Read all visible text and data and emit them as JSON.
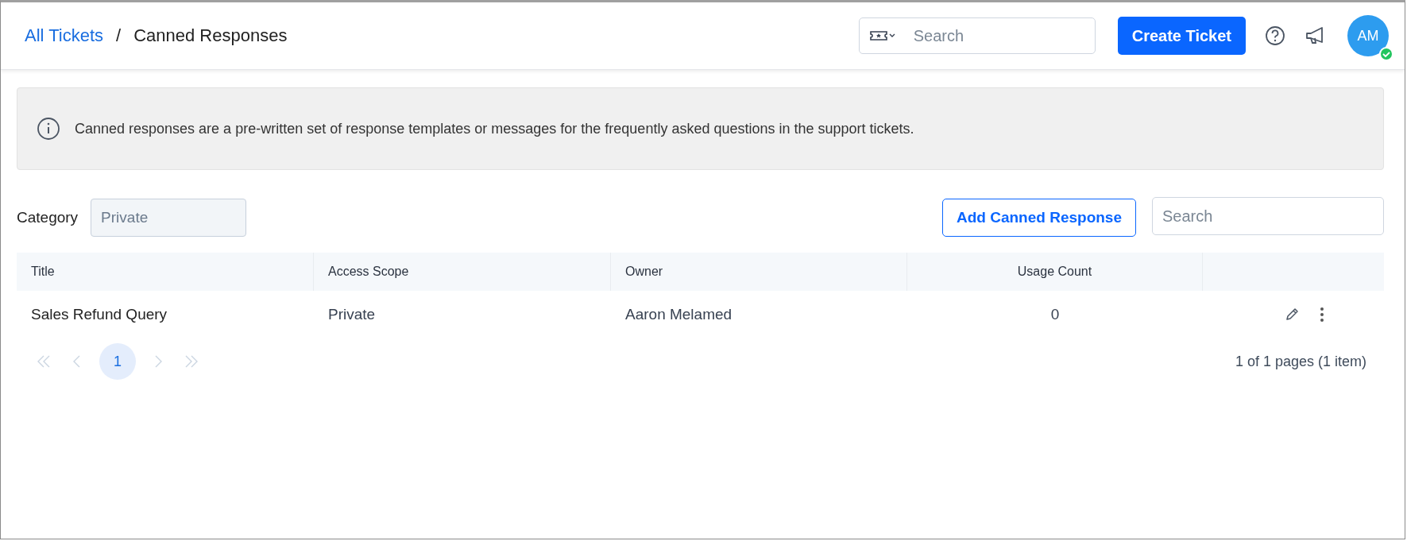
{
  "header": {
    "breadcrumb": [
      {
        "label": "All Tickets",
        "kind": "link"
      },
      {
        "label": "/",
        "kind": "separator"
      },
      {
        "label": "Canned Responses",
        "kind": "current"
      }
    ],
    "search": {
      "placeholder": "Search"
    },
    "create_button": "Create Ticket",
    "avatar": {
      "initials": "AM",
      "online": true
    }
  },
  "info_banner": "Canned responses are a pre-written set of response templates or messages for the frequently asked questions in the support tickets.",
  "toolbar": {
    "category_label": "Category",
    "category_value": "Private",
    "category_disabled": true,
    "add_button": "Add Canned Response",
    "search": {
      "placeholder": "Search"
    }
  },
  "table": {
    "columns": [
      {
        "label": "Title"
      },
      {
        "label": "Access Scope"
      },
      {
        "label": "Owner"
      },
      {
        "label": "Usage Count"
      }
    ],
    "rows": [
      {
        "title": "Sales Refund Query",
        "access_scope": "Private",
        "owner": "Aaron Melamed",
        "usage_count": "0"
      }
    ]
  },
  "pagination": {
    "first_disabled": true,
    "prev_disabled": true,
    "next_disabled": true,
    "last_disabled": true,
    "pages": [
      {
        "label": "1",
        "selected": true
      }
    ],
    "summary": "1 of 1 pages (1 item)"
  }
}
